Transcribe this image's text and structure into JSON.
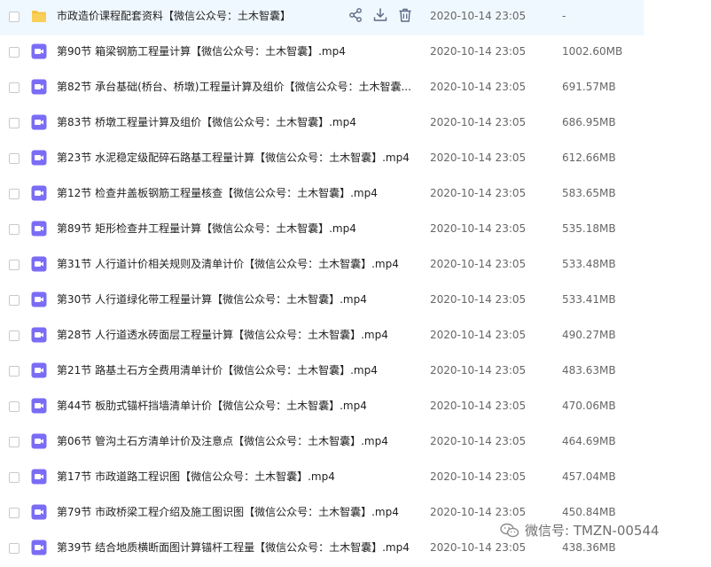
{
  "rows": [
    {
      "name": "市政造价课程配套资料【微信公众号：土木智囊】",
      "type": "folder",
      "date": "2020-10-14 23:05",
      "size": "-"
    },
    {
      "name": "第90节 箱梁钢筋工程量计算【微信公众号：土木智囊】.mp4",
      "type": "video",
      "date": "2020-10-14 23:05",
      "size": "1002.60MB"
    },
    {
      "name": "第82节 承台基础(桥台、桥墩)工程量计算及组价【微信公众号：土木智囊...",
      "type": "video",
      "date": "2020-10-14 23:05",
      "size": "691.57MB"
    },
    {
      "name": "第83节 桥墩工程量计算及组价【微信公众号：土木智囊】.mp4",
      "type": "video",
      "date": "2020-10-14 23:05",
      "size": "686.95MB"
    },
    {
      "name": "第23节 水泥稳定级配碎石路基工程量计算【微信公众号：土木智囊】.mp4",
      "type": "video",
      "date": "2020-10-14 23:05",
      "size": "612.66MB"
    },
    {
      "name": "第12节 检查井盖板钢筋工程量核查【微信公众号：土木智囊】.mp4",
      "type": "video",
      "date": "2020-10-14 23:05",
      "size": "583.65MB"
    },
    {
      "name": "第89节 矩形检查井工程量计算【微信公众号：土木智囊】.mp4",
      "type": "video",
      "date": "2020-10-14 23:05",
      "size": "535.18MB"
    },
    {
      "name": "第31节 人行道计价相关规则及清单计价【微信公众号：土木智囊】.mp4",
      "type": "video",
      "date": "2020-10-14 23:05",
      "size": "533.48MB"
    },
    {
      "name": "第30节 人行道绿化带工程量计算【微信公众号：土木智囊】.mp4",
      "type": "video",
      "date": "2020-10-14 23:05",
      "size": "533.41MB"
    },
    {
      "name": "第28节 人行道透水砖面层工程量计算【微信公众号：土木智囊】.mp4",
      "type": "video",
      "date": "2020-10-14 23:05",
      "size": "490.27MB"
    },
    {
      "name": "第21节 路基土石方全费用清单计价【微信公众号：土木智囊】.mp4",
      "type": "video",
      "date": "2020-10-14 23:05",
      "size": "483.63MB"
    },
    {
      "name": "第44节 板肋式锚杆挡墙清单计价【微信公众号：土木智囊】.mp4",
      "type": "video",
      "date": "2020-10-14 23:05",
      "size": "470.06MB"
    },
    {
      "name": "第06节 管沟土石方清单计价及注意点【微信公众号：土木智囊】.mp4",
      "type": "video",
      "date": "2020-10-14 23:05",
      "size": "464.69MB"
    },
    {
      "name": "第17节 市政道路工程识图【微信公众号：土木智囊】.mp4",
      "type": "video",
      "date": "2020-10-14 23:05",
      "size": "457.04MB"
    },
    {
      "name": "第79节 市政桥梁工程介绍及施工图识图【微信公众号：土木智囊】.mp4",
      "type": "video",
      "date": "2020-10-14 23:05",
      "size": "450.84MB"
    },
    {
      "name": "第39节 结合地质横断面图计算锚杆工程量【微信公众号：土木智囊】.mp4",
      "type": "video",
      "date": "2020-10-14 23:05",
      "size": "438.36MB"
    }
  ],
  "row_actions": [
    {
      "icon": "share-icon"
    },
    {
      "icon": "download-icon"
    },
    {
      "icon": "trash-icon"
    }
  ],
  "watermark": {
    "text": "微信号: TMZN-00544",
    "icon": "wechat-icon"
  },
  "colors": {
    "folder": "#f6c344",
    "video": "#7b6cf6",
    "hover_row": "#f0f8ff",
    "action_icon": "#5a6a85"
  }
}
